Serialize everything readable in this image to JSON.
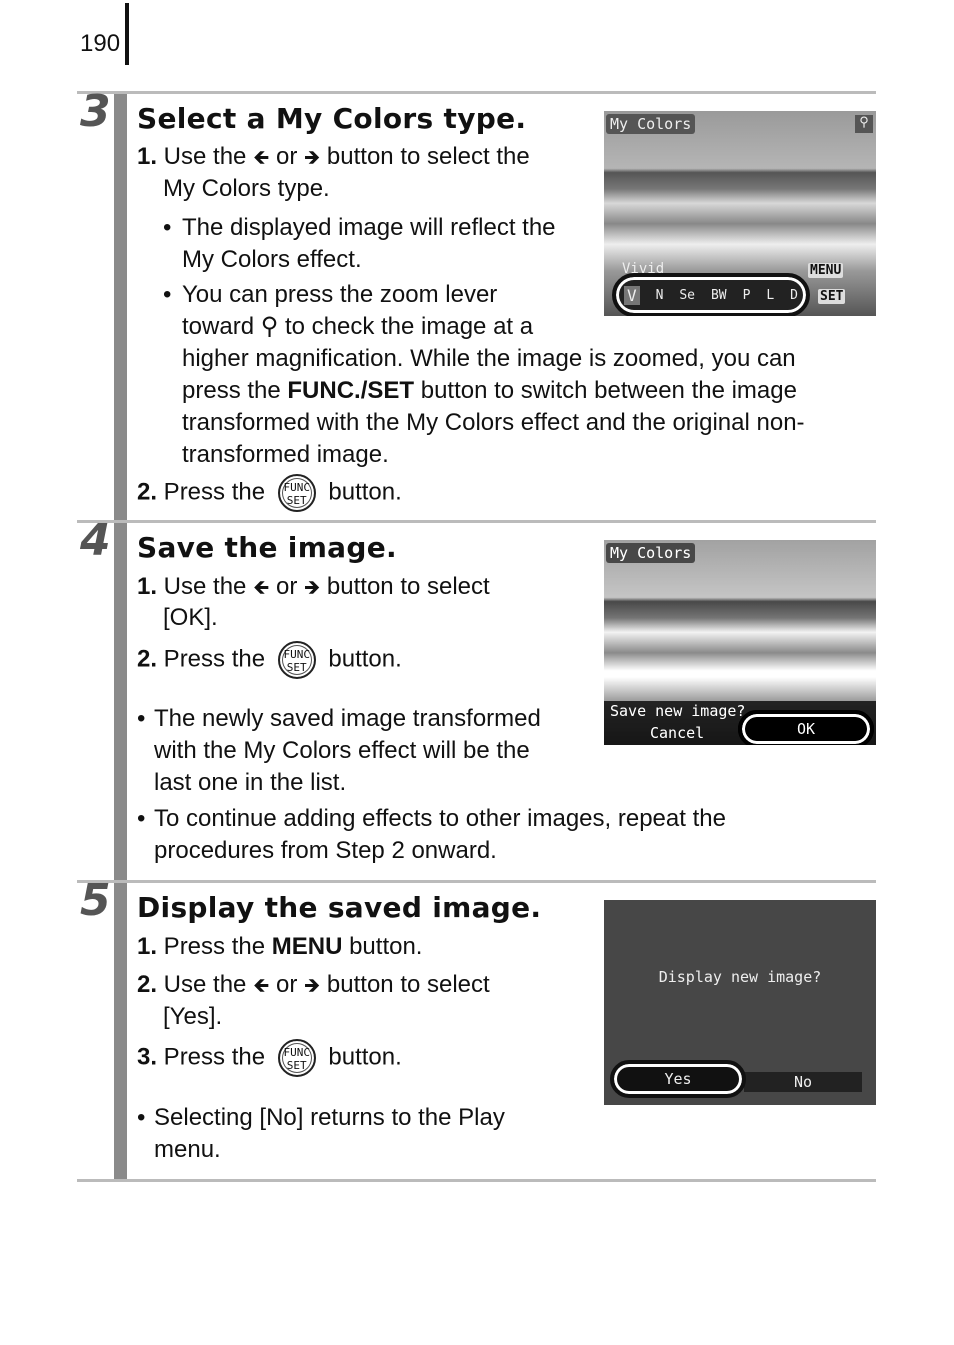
{
  "page_number": "190",
  "steps": [
    {
      "number": "3",
      "title": "Select a My Colors type.",
      "lines": {
        "l1a": "1.",
        "l1b": " Use the ",
        "l1c": " or ",
        "l1d": " button to select the",
        "l2": "My Colors type.",
        "b1a": "The displayed image will reflect the",
        "b1b": "My Colors effect.",
        "b2a": "You can press the zoom lever",
        "b2b1": "toward ",
        "b2b2": " to check the image at a",
        "b2c": "higher magnification. While the image is zoomed, you can",
        "b2d1": "press the ",
        "b2d2": "FUNC./SET",
        "b2d3": " button to switch between the image",
        "b2e": "transformed with the My Colors effect and the original non-",
        "b2f": "transformed image.",
        "s2a": "2.",
        "s2b": " Press the ",
        "s2c": " button."
      },
      "screen": {
        "title": "My Colors",
        "label": "Vivid",
        "menu": "MENU",
        "set": "SET",
        "types": [
          "V",
          "N",
          "Se",
          "BW",
          "P",
          "L",
          "D"
        ]
      }
    },
    {
      "number": "4",
      "title": "Save the image.",
      "lines": {
        "l1a": "1.",
        "l1b": " Use the ",
        "l1c": " or ",
        "l1d": " button to select",
        "l2": "[OK].",
        "s2a": "2.",
        "s2b": " Press the ",
        "s2c": " button.",
        "b1a": "The newly saved image transformed",
        "b1b": "with the My Colors effect will be the",
        "b1c": "last one in the list.",
        "b2a": "To continue adding effects to other images, repeat the",
        "b2b": "procedures from Step 2 onward."
      },
      "screen": {
        "title": "My Colors",
        "prompt": "Save new image?",
        "cancel": "Cancel",
        "ok": "OK"
      }
    },
    {
      "number": "5",
      "title": "Display the saved image.",
      "lines": {
        "l1a": "1.",
        "l1b": " Press the ",
        "l1c": "MENU",
        "l1d": " button.",
        "s2a": "2.",
        "s2b": " Use the ",
        "s2c": " or ",
        "s2d": " button to select",
        "s2e": "[Yes].",
        "s3a": "3.",
        "s3b": " Press the ",
        "s3c": " button.",
        "b1a": "Selecting [No] returns to the Play",
        "b1b": "menu."
      },
      "screen": {
        "prompt": "Display new image?",
        "yes": "Yes",
        "no": "No"
      }
    }
  ],
  "icons": {
    "left": "left-arrow-icon",
    "right": "right-arrow-icon",
    "zoom": "magnifier-icon",
    "func": "func-set-button-icon"
  },
  "func_icon": {
    "top": "FUNC",
    "bottom": "SET"
  },
  "glyphs": {
    "bullet": "•",
    "left": "🡸",
    "right": "🡺"
  }
}
